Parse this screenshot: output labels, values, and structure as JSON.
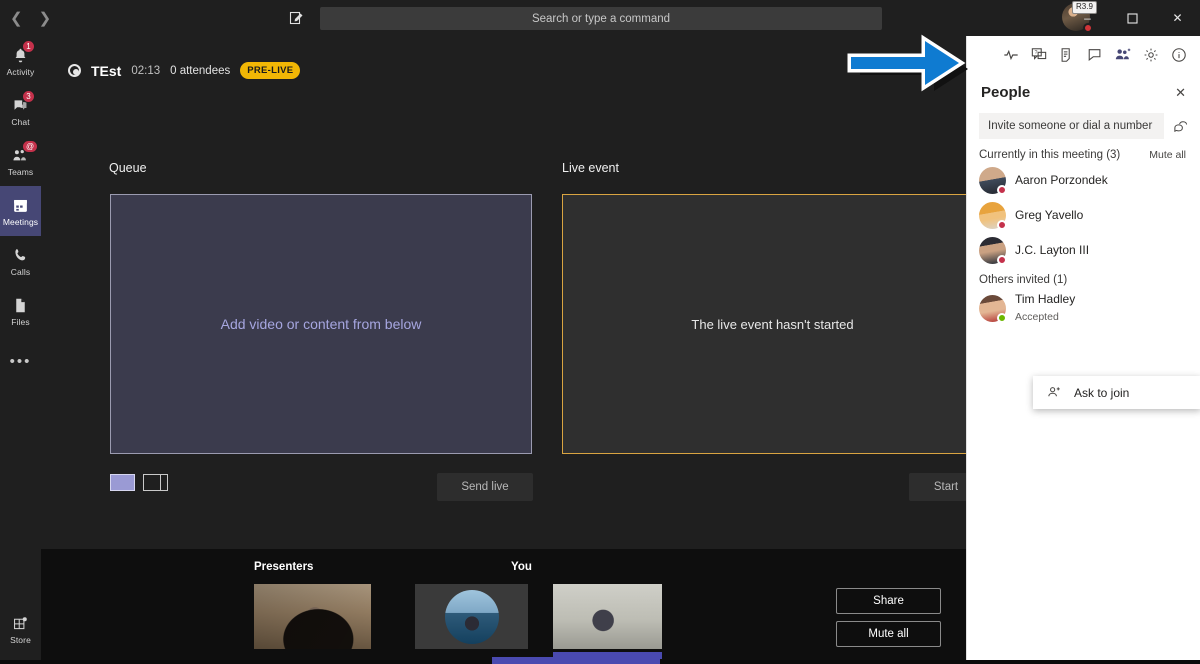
{
  "titlebar": {
    "back_icon": "chevron-left-icon",
    "forward_icon": "chevron-right-icon",
    "compose_icon": "compose-icon",
    "search_placeholder": "Search or type a command",
    "avatar_badge": "R3.9",
    "minimize": "–",
    "maximize": "❐",
    "close": "✕"
  },
  "rail": {
    "items": [
      {
        "label": "Activity",
        "icon": "bell-icon",
        "badge": "1",
        "active": false
      },
      {
        "label": "Chat",
        "icon": "chat-icon",
        "badge": "3",
        "active": false
      },
      {
        "label": "Teams",
        "icon": "teams-icon",
        "badge": "@",
        "active": false
      },
      {
        "label": "Meetings",
        "icon": "calendar-icon",
        "badge": "",
        "active": true
      },
      {
        "label": "Calls",
        "icon": "phone-icon",
        "badge": "",
        "active": false
      },
      {
        "label": "Files",
        "icon": "files-icon",
        "badge": "",
        "active": false
      }
    ],
    "more_label": "•••",
    "store_label": "Store"
  },
  "event": {
    "title": "TEst",
    "timer": "02:13",
    "attendees": "0 attendees",
    "status_pill": "PRE-LIVE",
    "record_icon": "record-icon"
  },
  "stage": {
    "queue_label": "Queue",
    "queue_placeholder": "Add video or content from below",
    "live_label": "Live event",
    "live_placeholder": "The live event hasn't started",
    "send_live_label": "Send live",
    "start_label": "Start",
    "layout_single": "layout-single-icon",
    "layout_split": "layout-split-icon",
    "queue_fill": "#3b3b4d",
    "live_border": "#d9a441",
    "pill_color": "#f2b705"
  },
  "bottombar": {
    "presenters_label": "Presenters",
    "you_label": "You",
    "share_label": "Share",
    "mute_all_label": "Mute all"
  },
  "right_panel": {
    "toolbar_icons": [
      {
        "name": "health-pulse-icon",
        "active": false
      },
      {
        "name": "qna-icon",
        "active": false
      },
      {
        "name": "notes-icon",
        "active": false
      },
      {
        "name": "chat-icon",
        "active": false
      },
      {
        "name": "people-icon",
        "active": true
      },
      {
        "name": "settings-gear-icon",
        "active": false
      },
      {
        "name": "info-icon",
        "active": false
      }
    ],
    "title": "People",
    "close_icon": "close-icon",
    "invite_placeholder": "Invite someone or dial a number",
    "dial_icon": "dialpad-icon",
    "section_meeting": "Currently in this meeting  (3)",
    "mute_all": "Mute all",
    "attendees": [
      {
        "name": "Aaron Porzondek",
        "status": "busy",
        "sub": ""
      },
      {
        "name": "Greg Yavello",
        "status": "busy",
        "sub": ""
      },
      {
        "name": "J.C. Layton III",
        "status": "busy",
        "sub": ""
      }
    ],
    "section_invited": "Others invited (1)",
    "invited": [
      {
        "name": "Tim Hadley",
        "status": "avail",
        "sub": "Accepted"
      }
    ],
    "context_menu": {
      "icon": "person-add-icon",
      "label": "Ask to join"
    }
  },
  "annotation": {
    "arrow_color": "#0f7bd1",
    "arrow_outline": "#ffffff",
    "arrow_shadow": "#111111",
    "name": "blue-arrow-annotation"
  }
}
